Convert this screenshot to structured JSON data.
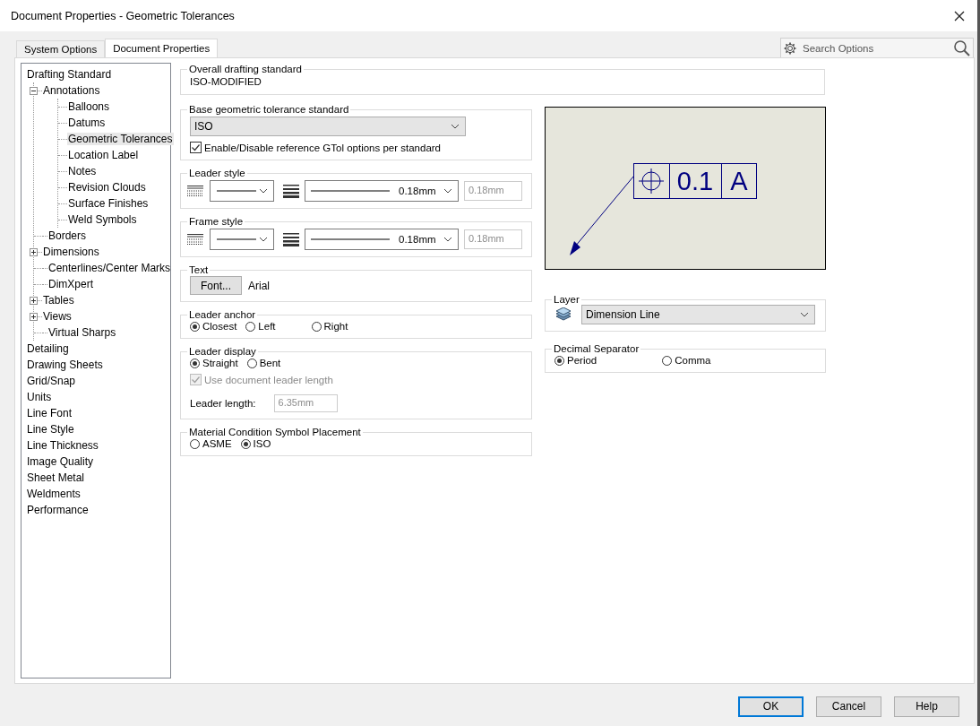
{
  "window": {
    "title": "Document Properties - Geometric Tolerances"
  },
  "tabs": [
    {
      "label": "System Options",
      "selected": false
    },
    {
      "label": "Document Properties",
      "selected": true
    }
  ],
  "search": {
    "placeholder": "Search Options"
  },
  "tree": [
    {
      "label": "Drafting Standard",
      "selected": false,
      "children": [
        {
          "label": "Annotations",
          "selected": false,
          "expanded": true,
          "children": [
            {
              "label": "Balloons",
              "selected": false
            },
            {
              "label": "Datums",
              "selected": false
            },
            {
              "label": "Geometric Tolerances",
              "selected": true
            },
            {
              "label": "Location Label",
              "selected": false
            },
            {
              "label": "Notes",
              "selected": false
            },
            {
              "label": "Revision Clouds",
              "selected": false
            },
            {
              "label": "Surface Finishes",
              "selected": false
            },
            {
              "label": "Weld Symbols",
              "selected": false
            }
          ]
        },
        {
          "label": "Borders",
          "selected": false
        },
        {
          "label": "Dimensions",
          "selected": false,
          "expanded": false
        },
        {
          "label": "Centerlines/Center Marks",
          "selected": false
        },
        {
          "label": "DimXpert",
          "selected": false
        },
        {
          "label": "Tables",
          "selected": false,
          "expanded": false
        },
        {
          "label": "Views",
          "selected": false,
          "expanded": false
        },
        {
          "label": "Virtual Sharps",
          "selected": false
        }
      ]
    },
    {
      "label": "Detailing",
      "selected": false
    },
    {
      "label": "Drawing Sheets",
      "selected": false
    },
    {
      "label": "Grid/Snap",
      "selected": false
    },
    {
      "label": "Units",
      "selected": false
    },
    {
      "label": "Line Font",
      "selected": false
    },
    {
      "label": "Line Style",
      "selected": false
    },
    {
      "label": "Line Thickness",
      "selected": false
    },
    {
      "label": "Image Quality",
      "selected": false
    },
    {
      "label": "Sheet Metal",
      "selected": false
    },
    {
      "label": "Weldments",
      "selected": false
    },
    {
      "label": "Performance",
      "selected": false
    }
  ],
  "overall_standard": {
    "legend": "Overall drafting standard",
    "value": "ISO-MODIFIED"
  },
  "base_standard": {
    "legend": "Base geometric tolerance standard",
    "value": "ISO",
    "checkbox": {
      "label": "Enable/Disable reference GTol options per standard",
      "checked": true
    }
  },
  "leader_style": {
    "legend": "Leader style",
    "thickness": "0.18mm",
    "custom": "0.18mm",
    "custom_disabled": true
  },
  "frame_style": {
    "legend": "Frame style",
    "thickness": "0.18mm",
    "custom": "0.18mm",
    "custom_disabled": true
  },
  "text": {
    "legend": "Text",
    "button": "Font...",
    "font": "Arial"
  },
  "leader_anchor": {
    "legend": "Leader anchor",
    "options": [
      {
        "label": "Closest",
        "selected": true
      },
      {
        "label": "Left",
        "selected": false
      },
      {
        "label": "Right",
        "selected": false
      }
    ]
  },
  "leader_display": {
    "legend": "Leader display",
    "options": [
      {
        "label": "Straight",
        "selected": true
      },
      {
        "label": "Bent",
        "selected": false
      }
    ],
    "checkbox": {
      "label": "Use document leader length",
      "checked": true,
      "disabled": true
    },
    "length_label": "Leader length:",
    "length": "6.35mm",
    "length_disabled": true
  },
  "material_condition": {
    "legend": "Material Condition Symbol Placement",
    "options": [
      {
        "label": "ASME",
        "selected": false
      },
      {
        "label": "ISO",
        "selected": true
      }
    ]
  },
  "preview": {
    "tolerance": "0.1",
    "datum": "A"
  },
  "layer": {
    "legend": "Layer",
    "value": "Dimension Line"
  },
  "decimal_separator": {
    "legend": "Decimal Separator",
    "options": [
      {
        "label": "Period",
        "selected": true
      },
      {
        "label": "Comma",
        "selected": false
      }
    ]
  },
  "buttons": [
    {
      "label": "OK",
      "default": true
    },
    {
      "label": "Cancel",
      "default": false
    },
    {
      "label": "Help",
      "default": false
    }
  ]
}
